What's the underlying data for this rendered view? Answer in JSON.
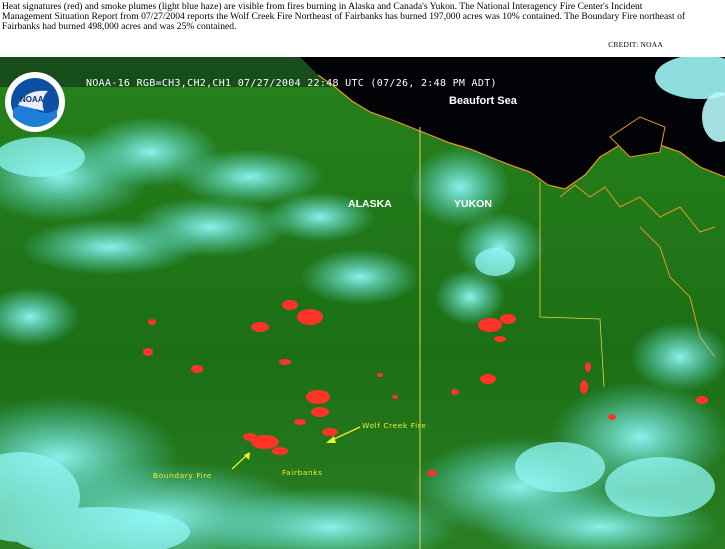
{
  "caption": "Heat signatures (red) and smoke plumes (light blue haze) are visible from fires burning in Alaska and Canada's Yukon. The National Interagency Fire Center's Incident Management Situation Report from 07/27/2004 reports the Wolf Creek Fire Northeast of Fairbanks has burned 197,000 acres was 10% contained.  The Boundary Fire northeast of Fairbanks had burned 498,000 acres and was 25% contained.",
  "credit": "CREDIT: NOAA",
  "image": {
    "header": "NOAA-16  RGB=CH3,CH2,CH1  07/27/2004  22:48 UTC (07/26, 2:48 PM ADT)",
    "logo_text": "NOAA",
    "labels": {
      "beaufort_sea": "Beaufort Sea",
      "alaska": "ALASKA",
      "yukon": "YUKON",
      "wolf_creek_fire": "Wolf Creek Fire",
      "boundary_fire": "Boundary Fire",
      "fairbanks": "Fairbanks"
    },
    "colors": {
      "vegetation": "#1e7a18",
      "smoke_cloud": "#74f2f2",
      "fire": "#ff3326",
      "ocean": "#020306",
      "coastline": "#e79a24",
      "border": "#e8d24a",
      "annotation": "#f2ee2a"
    }
  }
}
